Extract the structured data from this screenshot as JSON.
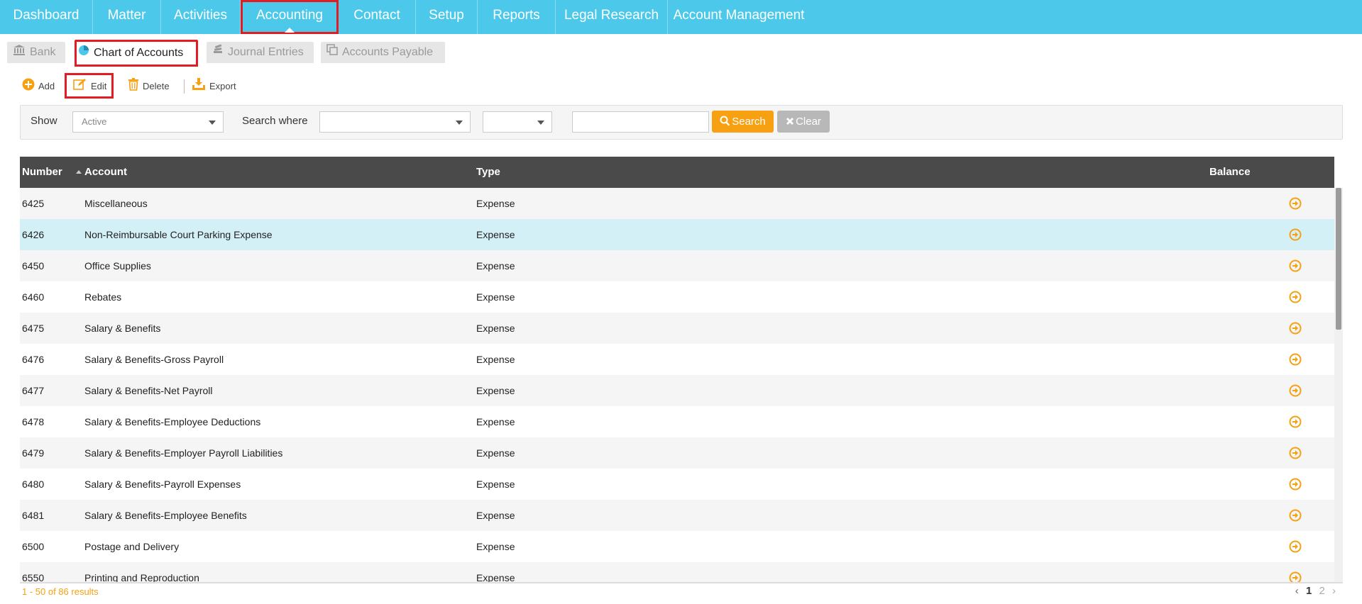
{
  "topnav": {
    "items": [
      {
        "label": "Dashboard"
      },
      {
        "label": "Matter"
      },
      {
        "label": "Activities"
      },
      {
        "label": "Accounting"
      },
      {
        "label": "Contact"
      },
      {
        "label": "Setup"
      },
      {
        "label": "Reports"
      },
      {
        "label": "Legal Research"
      },
      {
        "label": "Account Management"
      }
    ],
    "active": "Accounting"
  },
  "subtabs": {
    "items": [
      {
        "label": "Bank",
        "icon": "bank-icon"
      },
      {
        "label": "Chart of Accounts",
        "icon": "pie-chart-icon"
      },
      {
        "label": "Journal Entries",
        "icon": "stack-icon"
      },
      {
        "label": "Accounts Payable",
        "icon": "copy-icon"
      }
    ],
    "active": "Chart of Accounts"
  },
  "toolbar": {
    "add_label": "Add",
    "edit_label": "Edit",
    "delete_label": "Delete",
    "export_label": "Export"
  },
  "filter": {
    "show_label": "Show",
    "show_value": "Active",
    "search_where_label": "Search where",
    "search_where_value": "",
    "operator_value": "",
    "search_text": "",
    "search_button": "Search",
    "clear_button": "Clear"
  },
  "grid": {
    "columns": {
      "number": "Number",
      "account": "Account",
      "type": "Type",
      "balance": "Balance"
    },
    "rows": [
      {
        "number": "6425",
        "account": "Miscellaneous",
        "type": "Expense",
        "balance": ""
      },
      {
        "number": "6426",
        "account": "Non-Reimbursable Court Parking Expense",
        "type": "Expense",
        "balance": ""
      },
      {
        "number": "6450",
        "account": "Office Supplies",
        "type": "Expense",
        "balance": ""
      },
      {
        "number": "6460",
        "account": "Rebates",
        "type": "Expense",
        "balance": ""
      },
      {
        "number": "6475",
        "account": "Salary & Benefits",
        "type": "Expense",
        "balance": ""
      },
      {
        "number": "6476",
        "account": "Salary & Benefits-Gross Payroll",
        "type": "Expense",
        "balance": ""
      },
      {
        "number": "6477",
        "account": "Salary & Benefits-Net Payroll",
        "type": "Expense",
        "balance": ""
      },
      {
        "number": "6478",
        "account": "Salary & Benefits-Employee Deductions",
        "type": "Expense",
        "balance": ""
      },
      {
        "number": "6479",
        "account": "Salary & Benefits-Employer Payroll Liabilities",
        "type": "Expense",
        "balance": ""
      },
      {
        "number": "6480",
        "account": "Salary & Benefits-Payroll Expenses",
        "type": "Expense",
        "balance": ""
      },
      {
        "number": "6481",
        "account": "Salary & Benefits-Employee Benefits",
        "type": "Expense",
        "balance": ""
      },
      {
        "number": "6500",
        "account": "Postage and Delivery",
        "type": "Expense",
        "balance": ""
      },
      {
        "number": "6550",
        "account": "Printing and Reproduction",
        "type": "Expense",
        "balance": ""
      }
    ],
    "selected_number": "6426"
  },
  "footer": {
    "results_text": "1 - 50 of 86 results",
    "pages": [
      "1",
      "2"
    ],
    "current_page": "1",
    "prev_symbol": "‹",
    "next_symbol": "›"
  },
  "colors": {
    "nav_bg": "#4cc9ea",
    "accent_orange": "#f7a012",
    "highlight_red": "#e31b23",
    "grid_header": "#4a4a4a",
    "selected_row": "#d4f0f7"
  }
}
